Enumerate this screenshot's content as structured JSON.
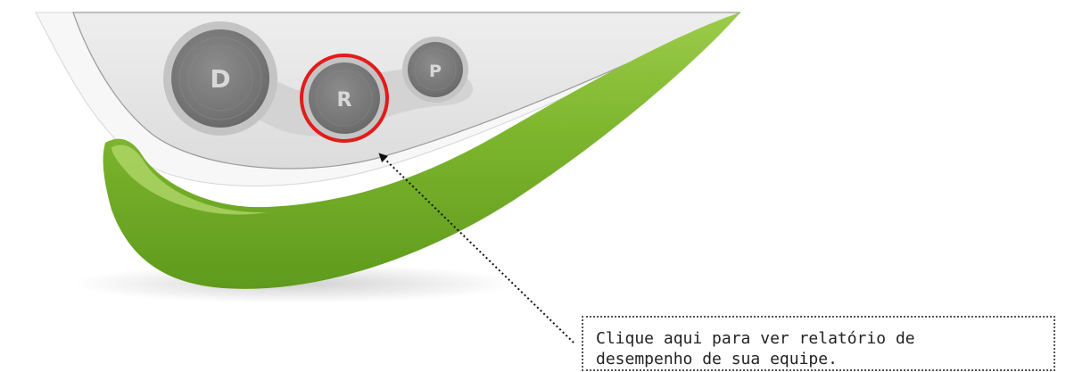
{
  "buttons": [
    {
      "name": "d-button",
      "label": "D"
    },
    {
      "name": "r-button",
      "label": "R"
    },
    {
      "name": "p-button",
      "label": "P"
    }
  ],
  "highlight": {
    "target": "R",
    "color": "#e31b1b"
  },
  "callout": {
    "text": "Clique aqui para ver relatório de\ndesempenho de sua equipe."
  },
  "colors": {
    "panel": "#e5e5e5",
    "accent_green": "#77b52a",
    "button_gray": "#7d7d7d"
  }
}
